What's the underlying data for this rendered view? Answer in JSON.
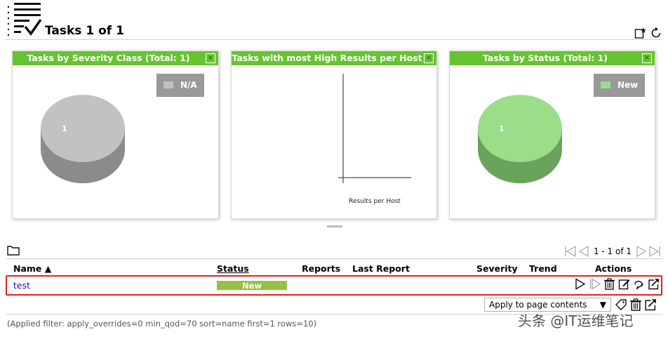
{
  "header": {
    "title": "Tasks 1 of 1",
    "icon": "task-list-icon",
    "buttons": [
      "new-task-icon",
      "refresh-icon"
    ]
  },
  "panels": [
    {
      "title": "Tasks by Severity Class (Total: 1)",
      "close": "×",
      "legend": {
        "label": "N/A",
        "color": "#c0c0c0"
      },
      "pie_label": "1",
      "pie_color": "#c2c2c2"
    },
    {
      "title": "Tasks with most High Results per Host",
      "close": "×",
      "xlabel": "Results per Host"
    },
    {
      "title": "Tasks by Status (Total: 1)",
      "close": "×",
      "legend": {
        "label": "New",
        "color": "#9ade89"
      },
      "pie_label": "1",
      "pie_color": "#9ade89"
    }
  ],
  "chart_data": [
    {
      "type": "pie",
      "title": "Tasks by Severity Class (Total: 1)",
      "categories": [
        "N/A"
      ],
      "values": [
        1
      ]
    },
    {
      "type": "bar",
      "title": "Tasks with most High Results per Host",
      "categories": [],
      "values": [],
      "xlabel": "Results per Host",
      "ylabel": ""
    },
    {
      "type": "pie",
      "title": "Tasks by Status (Total: 1)",
      "categories": [
        "New"
      ],
      "values": [
        1
      ]
    }
  ],
  "pager": {
    "text": "1 - 1 of 1"
  },
  "table": {
    "columns": {
      "name": "Name ▲",
      "status": "Status",
      "reports": "Reports",
      "last_report": "Last Report",
      "severity": "Severity",
      "trend": "Trend",
      "actions": "Actions"
    },
    "rows": [
      {
        "name": "test",
        "status": "New",
        "reports": "",
        "last_report": "",
        "severity": "",
        "trend": ""
      }
    ]
  },
  "bulk": {
    "selected": "Apply to page contents",
    "arrow": "▼"
  },
  "filter_text": "(Applied filter: apply_overrides=0 min_qod=70 sort=name first=1 rows=10)",
  "watermark": "头条 @IT运维笔记",
  "colors": {
    "panel_header": "#66c430",
    "status_new": "#98bf44",
    "highlight": "#e2231a",
    "link": "#1a0dab"
  }
}
